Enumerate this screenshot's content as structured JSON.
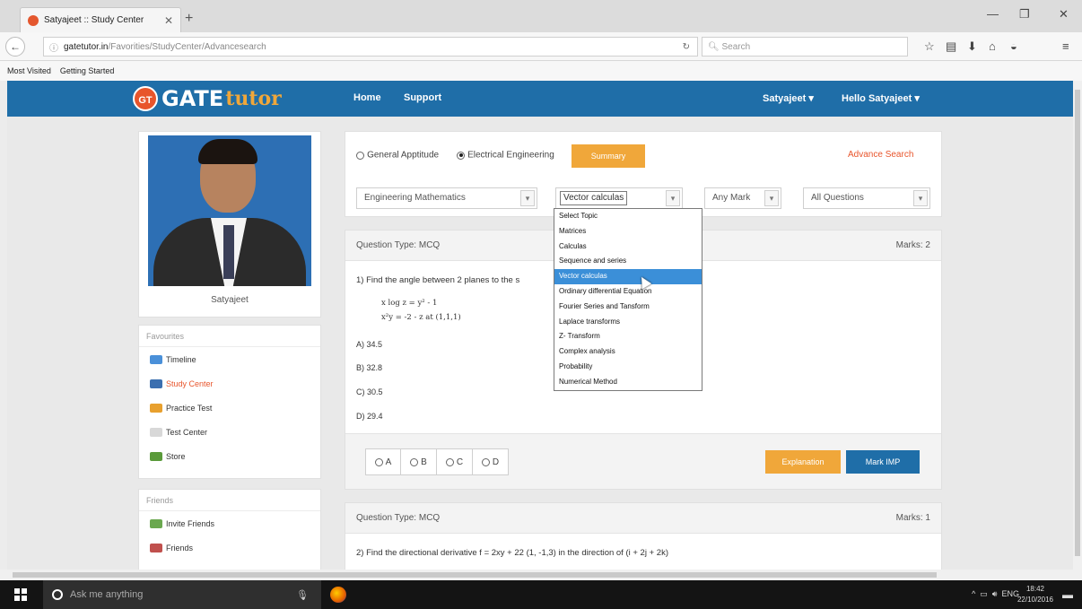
{
  "browser": {
    "tab_title": "Satyajeet :: Study Center",
    "url_domain": "gatetutor.in",
    "url_path": "/Favorities/StudyCenter/Advancesearch",
    "search_placeholder": "Search",
    "bookmarks": [
      "Most Visited",
      "Getting Started"
    ]
  },
  "header": {
    "logo_badge": "GT",
    "logo_gate": "GATE",
    "logo_tutor": "tutor",
    "nav": [
      "Home",
      "Support"
    ],
    "user_menu": "Satyajeet",
    "hello_menu": "Hello Satyajeet"
  },
  "profile": {
    "name": "Satyajeet"
  },
  "favourites": {
    "heading": "Favourites",
    "items": [
      "Timeline",
      "Study Center",
      "Practice Test",
      "Test Center",
      "Store"
    ]
  },
  "friends": {
    "heading": "Friends",
    "items": [
      "Invite Friends",
      "Friends"
    ]
  },
  "filters": {
    "radio_general": "General Apptitude",
    "radio_electrical": "Electrical Engineering",
    "summary_label": "Summary",
    "advance_search": "Advance Search",
    "subject": "Engineering Mathematics",
    "topic": "Vector calculas",
    "mark": "Any Mark",
    "questions": "All Questions"
  },
  "topic_options": [
    "Select Topic",
    "Matrices",
    "Calculas",
    "Sequence and series",
    "Vector calculas",
    "Ordinary differential Equation",
    "Fourier Series and Tansform",
    "Laplace transforms",
    "Z- Transform",
    "Complex analysis",
    "Probability",
    "Numerical Method"
  ],
  "question1": {
    "type_label": "Question Type: MCQ",
    "marks": "Marks: 2",
    "text": "1) Find the angle between 2 planes to the s",
    "formula_line1": "x log z = y² - 1",
    "formula_line2": "x²y = -2 - z     at (1,1,1)",
    "options": [
      "A) 34.5",
      "B) 32.8",
      "C) 30.5",
      "D) 29.4"
    ],
    "answers": [
      "A",
      "B",
      "C",
      "D"
    ],
    "explanation_label": "Explanation",
    "markimp_label": "Mark IMP"
  },
  "question2": {
    "type_label": "Question Type: MCQ",
    "marks": "Marks: 1",
    "text": "2) Find the directional derivative f = 2xy + 22  (1, -1,3) in the direction of (i + 2j + 2k)"
  },
  "taskbar": {
    "search_placeholder": "Ask me anything",
    "lang": "ENG",
    "time": "18:42",
    "date": "22/10/2016"
  }
}
